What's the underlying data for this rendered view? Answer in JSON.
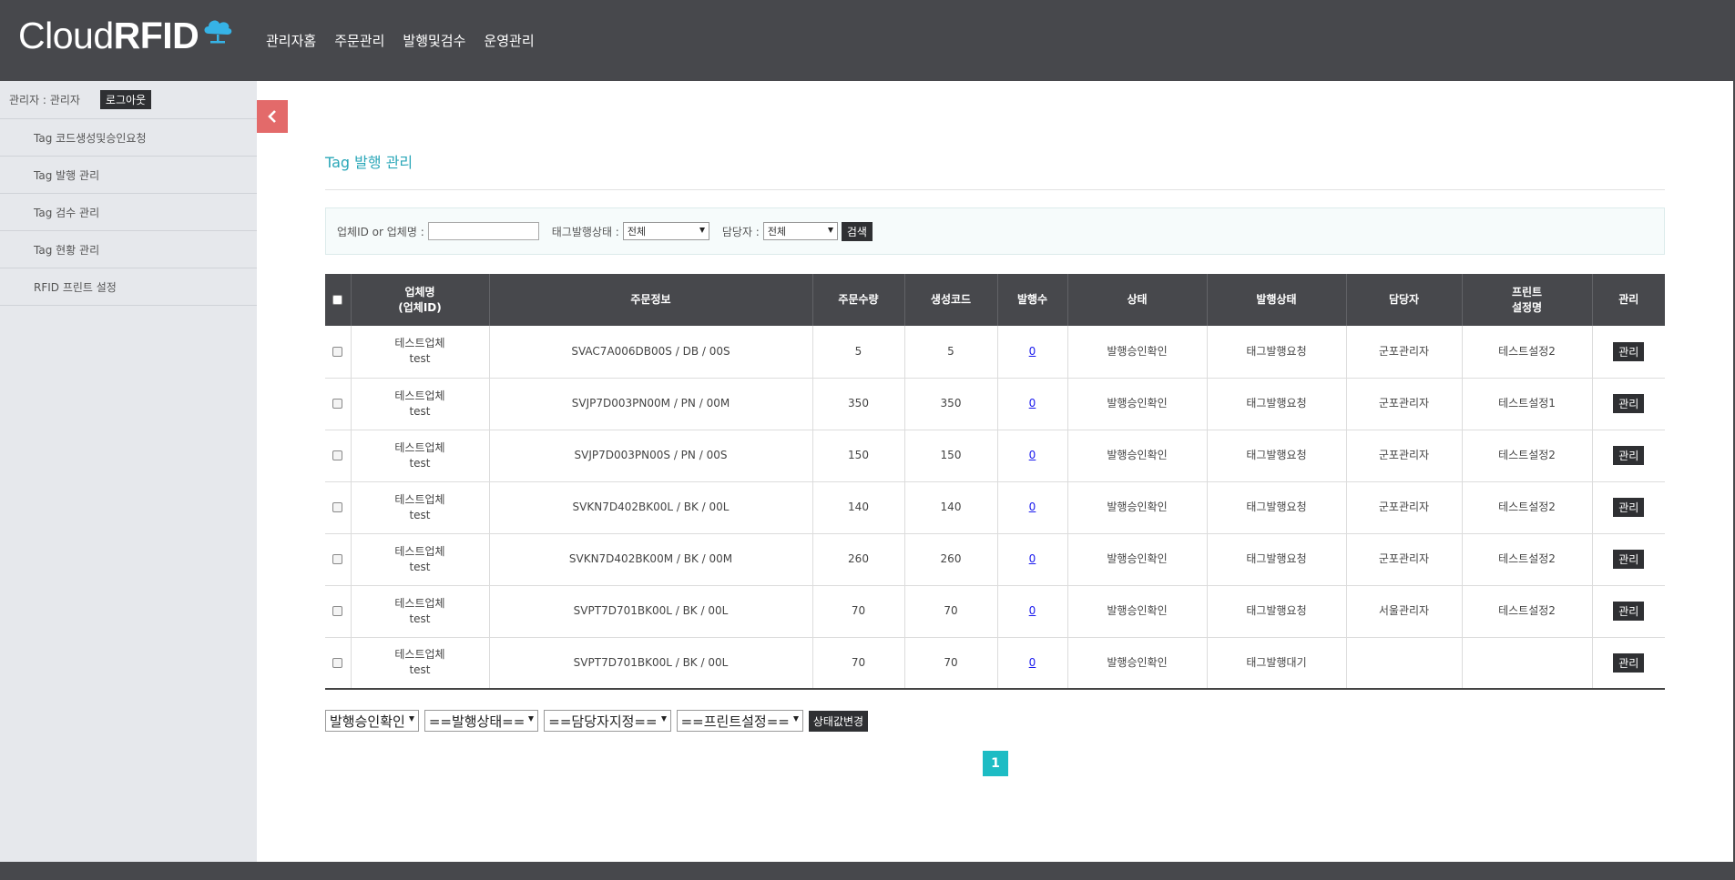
{
  "header": {
    "logo_light": "Cloud",
    "logo_bold": "RFID",
    "nav": [
      "관리자홈",
      "주문관리",
      "발행및검수",
      "운영관리"
    ]
  },
  "sidebar": {
    "user_label": "관리자 : 관리자",
    "logout_label": "로그아웃",
    "items": [
      {
        "label": "Tag 코드생성및승인요청"
      },
      {
        "label": "Tag 발행 관리"
      },
      {
        "label": "Tag 검수 관리"
      },
      {
        "label": "Tag 현황 관리"
      },
      {
        "label": "RFID 프린트 설정"
      }
    ]
  },
  "main": {
    "title": "Tag 발행 관리",
    "search": {
      "company_label": "업체ID or 업체명 :",
      "company_value": "",
      "status_label": "태그발행상태 :",
      "status_value": "전체",
      "manager_label": "담당자 :",
      "manager_value": "전체",
      "search_button": "검색"
    },
    "table": {
      "headers": {
        "company": "업체명",
        "company_sub": "(업체ID)",
        "order_info": "주문정보",
        "order_qty": "주문수량",
        "gen_code": "생성코드",
        "issued": "발행수",
        "status": "상태",
        "issue_status": "발행상태",
        "manager": "담당자",
        "print": "프린트",
        "print_sub": "설정명",
        "manage": "관리"
      },
      "rows": [
        {
          "company": "테스트업체",
          "company_id": "test",
          "order_info": "SVAC7A006DB00S / DB / 00S",
          "order_qty": "5",
          "gen_code": "5",
          "issued": "0",
          "status": "발행승인확인",
          "issue_status": "태그발행요청",
          "manager": "군포관리자",
          "print": "테스트설정2",
          "manage": "관리"
        },
        {
          "company": "테스트업체",
          "company_id": "test",
          "order_info": "SVJP7D003PN00M / PN / 00M",
          "order_qty": "350",
          "gen_code": "350",
          "issued": "0",
          "status": "발행승인확인",
          "issue_status": "태그발행요청",
          "manager": "군포관리자",
          "print": "테스트설정1",
          "manage": "관리"
        },
        {
          "company": "테스트업체",
          "company_id": "test",
          "order_info": "SVJP7D003PN00S / PN / 00S",
          "order_qty": "150",
          "gen_code": "150",
          "issued": "0",
          "status": "발행승인확인",
          "issue_status": "태그발행요청",
          "manager": "군포관리자",
          "print": "테스트설정2",
          "manage": "관리"
        },
        {
          "company": "테스트업체",
          "company_id": "test",
          "order_info": "SVKN7D402BK00L / BK / 00L",
          "order_qty": "140",
          "gen_code": "140",
          "issued": "0",
          "status": "발행승인확인",
          "issue_status": "태그발행요청",
          "manager": "군포관리자",
          "print": "테스트설정2",
          "manage": "관리"
        },
        {
          "company": "테스트업체",
          "company_id": "test",
          "order_info": "SVKN7D402BK00M / BK / 00M",
          "order_qty": "260",
          "gen_code": "260",
          "issued": "0",
          "status": "발행승인확인",
          "issue_status": "태그발행요청",
          "manager": "군포관리자",
          "print": "테스트설정2",
          "manage": "관리"
        },
        {
          "company": "테스트업체",
          "company_id": "test",
          "order_info": "SVPT7D701BK00L / BK / 00L",
          "order_qty": "70",
          "gen_code": "70",
          "issued": "0",
          "status": "발행승인확인",
          "issue_status": "태그발행요청",
          "manager": "서울관리자",
          "print": "테스트설정2",
          "manage": "관리"
        },
        {
          "company": "테스트업체",
          "company_id": "test",
          "order_info": "SVPT7D701BK00L / BK / 00L",
          "order_qty": "70",
          "gen_code": "70",
          "issued": "0",
          "status": "발행승인확인",
          "issue_status": "태그발행대기",
          "manager": "",
          "print": "",
          "manage": "관리"
        }
      ]
    },
    "bulk": {
      "status_select": "발행승인확인",
      "issue_select": "==발행상태==",
      "manager_select": "==담당자지정==",
      "print_select": "==프린트설정==",
      "apply_button": "상태값변경"
    },
    "pagination": {
      "current": "1"
    }
  },
  "colors": {
    "header_bg": "#47484c",
    "accent": "#2aa7b8",
    "collapse_btn": "#e36a6a",
    "pager": "#1dbcc4"
  }
}
